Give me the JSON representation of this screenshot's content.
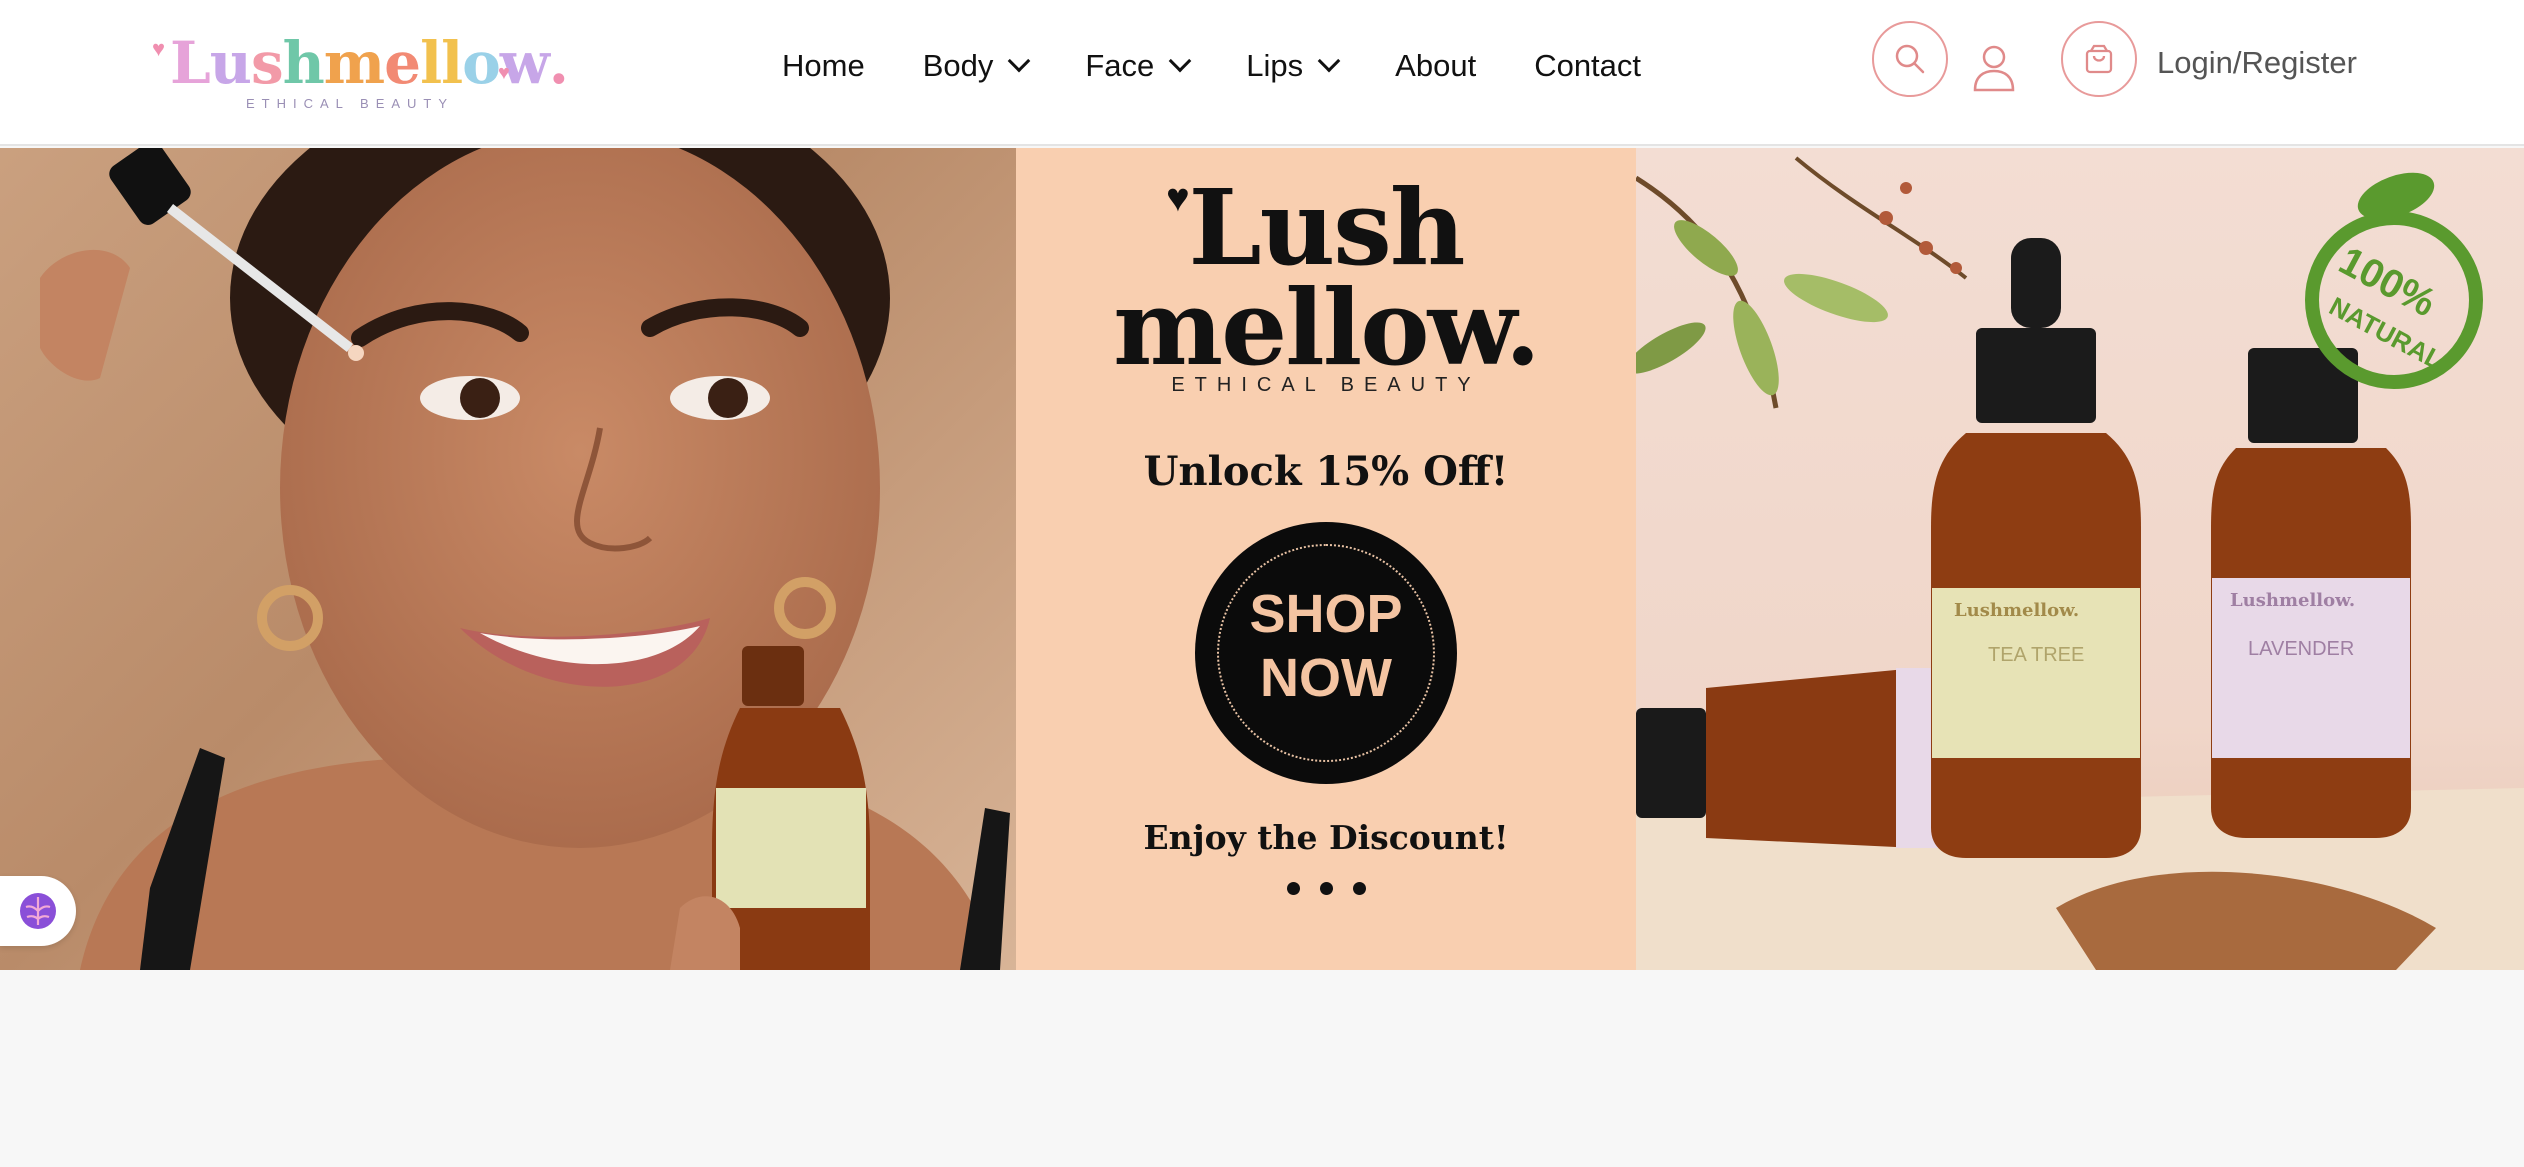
{
  "header": {
    "logo": {
      "letters": [
        "L",
        "u",
        "s",
        "h",
        "m",
        "e",
        "l",
        "l",
        "o",
        "w",
        "."
      ],
      "letter_colors": [
        "#e6a3d9",
        "#c7a6e8",
        "#f29aa8",
        "#6fc7a8",
        "#f0a24d",
        "#f28a74",
        "#f2c14e",
        "#f2c14e",
        "#9ad1e8",
        "#c7a6e8",
        "#f08fb0"
      ],
      "tagline": "ETHICAL BEAUTY"
    },
    "nav": [
      {
        "label": "Home",
        "has_dropdown": false
      },
      {
        "label": "Body",
        "has_dropdown": true
      },
      {
        "label": "Face",
        "has_dropdown": true
      },
      {
        "label": "Lips",
        "has_dropdown": true
      },
      {
        "label": "About",
        "has_dropdown": false
      },
      {
        "label": "Contact",
        "has_dropdown": false
      }
    ],
    "login_label": "Login/Register",
    "icons": {
      "search": "search-icon",
      "user": "user-icon",
      "cart": "shopping-bag-icon"
    },
    "accent_color": "#e89a9a"
  },
  "hero": {
    "brand_line1": "Lush",
    "brand_line2": "mellow.",
    "brand_tagline": "ETHICAL BEAUTY",
    "offer": "Unlock 15% Off!",
    "cta_line1": "SHOP",
    "cta_line2": "NOW",
    "footer_text": "Enjoy the Discount!",
    "badge_line1": "100%",
    "badge_line2": "NATURAL",
    "bottle_brand": "Lushmellow.",
    "bottle_left_label": "TEA TREE",
    "bottle_right_label": "LAVENDER",
    "slide_count": 3,
    "mid_bg": "#f9cfb0"
  },
  "widget": {
    "icon": "brain-icon"
  }
}
